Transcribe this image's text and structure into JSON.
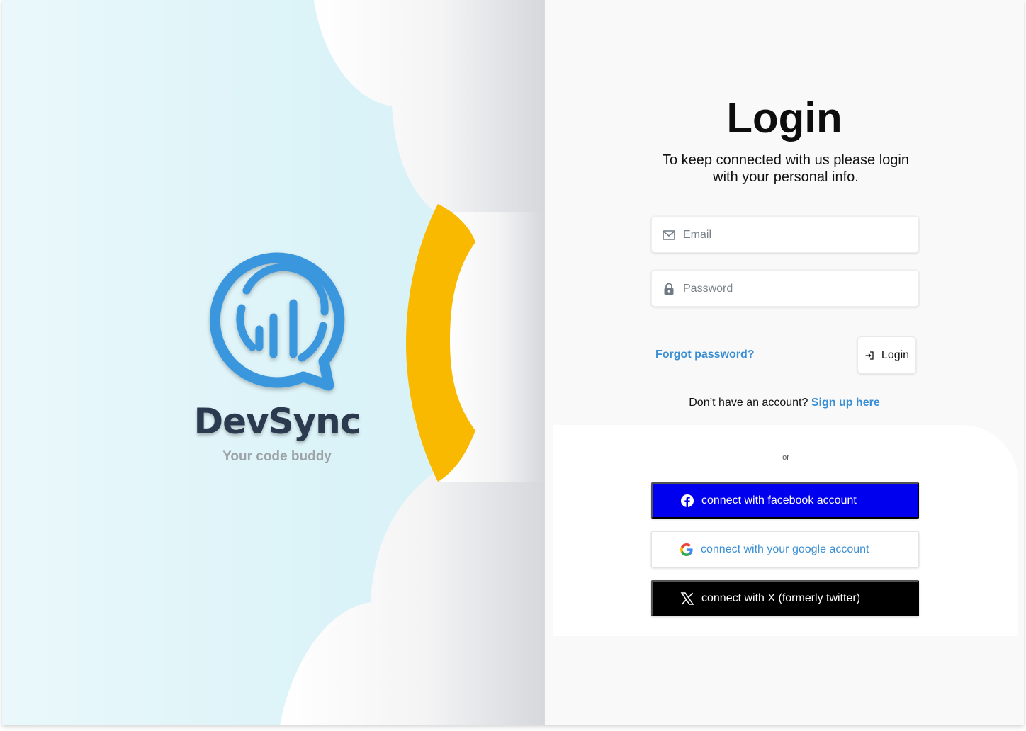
{
  "brand": {
    "name": "DevSync",
    "tagline": "Your code buddy",
    "primary_color": "#3b97dd",
    "accent_color": "#f9b900"
  },
  "login": {
    "title": "Login",
    "subtitle": "To keep connected with us please login with your personal info.",
    "email": {
      "placeholder": "Email",
      "value": "",
      "icon": "mail-icon"
    },
    "password": {
      "placeholder": "Password",
      "value": "",
      "icon": "lock-icon"
    },
    "forgot_password": "Forgot password?",
    "login_button": {
      "label": "Login",
      "icon": "sign-in-icon"
    },
    "signup_prompt": "Don’t have an account?",
    "signup_link": "Sign up here"
  },
  "social": {
    "divider": "or",
    "facebook": {
      "label": "connect with facebook account",
      "icon": "facebook-icon",
      "color": "#0000ee"
    },
    "google": {
      "label": "connect with your google account",
      "icon": "google-icon",
      "color": "#3a8fd4"
    },
    "x": {
      "label": "connect with X (formerly twitter)",
      "icon": "x-icon",
      "color": "#000000"
    }
  }
}
